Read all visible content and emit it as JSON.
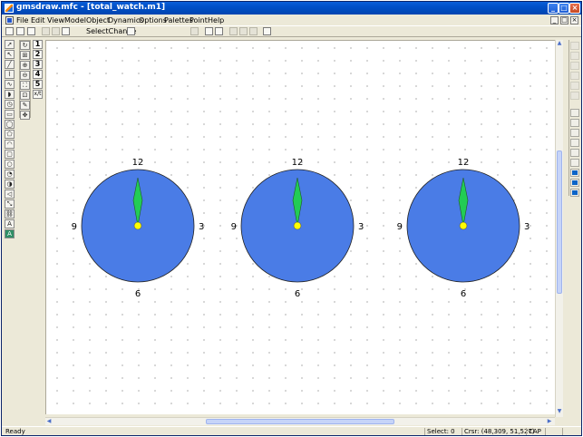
{
  "window": {
    "title": "gmsdraw.mfc - [total_watch.m1]",
    "controls": [
      "_",
      "□",
      "×"
    ]
  },
  "menu": {
    "items": [
      {
        "label": "File"
      },
      {
        "label": "Edit"
      },
      {
        "label": "View"
      },
      {
        "label": "Model"
      },
      {
        "label": "Object"
      },
      {
        "label": "Dynamics"
      },
      {
        "label": "Options"
      },
      {
        "label": "Palettes"
      },
      {
        "label": "Point"
      },
      {
        "label": "Help"
      }
    ],
    "mdi_controls": [
      "_",
      "□",
      "×"
    ]
  },
  "toolbar": {
    "select_change_label": "SelectChange"
  },
  "number_palette": [
    "1",
    "2",
    "3",
    "4",
    "5",
    "x/t"
  ],
  "tool_palette": {
    "text_tool": "A",
    "text_box_tool": "A"
  },
  "clocks": [
    {
      "top": "12",
      "right": "3",
      "bottom": "6",
      "left": "9"
    },
    {
      "top": "12",
      "right": "3",
      "bottom": "6",
      "left": "9"
    },
    {
      "top": "12",
      "right": "3",
      "bottom": "6",
      "left": "9"
    }
  ],
  "colors": {
    "clock_face": "#4a7ce6",
    "clock_hand": "#22cc55",
    "pivot": "#ffff00",
    "title_bar": "#0055d4",
    "scroll_thumb": "#c6d4f8"
  },
  "status": {
    "ready": "Ready",
    "select": "Select: 0",
    "cursor": "Crsr: (48,309, 51,527)",
    "cap": "CAP"
  }
}
